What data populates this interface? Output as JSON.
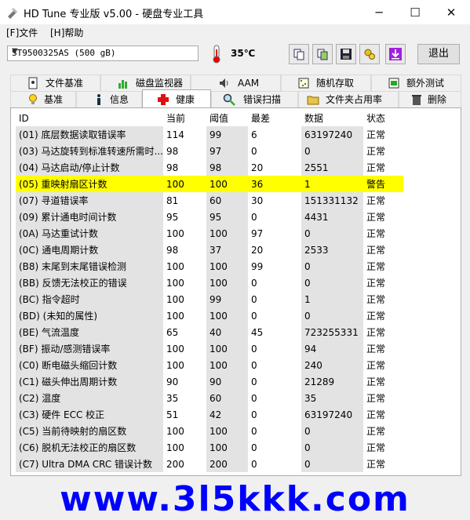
{
  "window": {
    "title": "HD Tune 专业版 v5.00 - 硬盘专业工具",
    "minimize": "─",
    "maximize": "☐",
    "close": "✕"
  },
  "menu": [
    "[F]文件",
    "[H]帮助"
  ],
  "toolbar": {
    "drive": "ST9500325AS (500 gB)",
    "temperature": "35℃",
    "buttons": [
      "copy-icon",
      "copy-info-icon",
      "save-icon",
      "options-icon",
      "download-icon"
    ],
    "exit_label": "退出"
  },
  "tabs_top": [
    "文件基准",
    "磁盘监视器",
    "AAM",
    "随机存取",
    "额外测试"
  ],
  "tabs_bottom": [
    "基准",
    "信息",
    "健康",
    "错误扫描",
    "文件夹占用率",
    "删除"
  ],
  "active_tab": "健康",
  "table": {
    "headers": [
      "ID",
      "当前",
      "阈值",
      "最差",
      "数据",
      "状态"
    ],
    "rows": [
      [
        "(01) 底层数据读取错误率",
        "114",
        "99",
        "6",
        "63197240",
        "正常"
      ],
      [
        "(03) 马达旋转到标准转速所需时...",
        "98",
        "97",
        "0",
        "0",
        "正常"
      ],
      [
        "(04) 马达启动/停止计数",
        "98",
        "98",
        "20",
        "2551",
        "正常"
      ],
      [
        "(05) 重映射扇区计数",
        "100",
        "100",
        "36",
        "1",
        "警告"
      ],
      [
        "(07) 寻道错误率",
        "81",
        "60",
        "30",
        "151331132",
        "正常"
      ],
      [
        "(09) 累计通电时间计数",
        "95",
        "95",
        "0",
        "4431",
        "正常"
      ],
      [
        "(0A) 马达重试计数",
        "100",
        "100",
        "97",
        "0",
        "正常"
      ],
      [
        "(0C) 通电周期计数",
        "98",
        "37",
        "20",
        "2533",
        "正常"
      ],
      [
        "(B8) 末尾到末尾错误检测",
        "100",
        "100",
        "99",
        "0",
        "正常"
      ],
      [
        "(BB) 反馈无法校正的错误",
        "100",
        "100",
        "0",
        "0",
        "正常"
      ],
      [
        "(BC) 指令超时",
        "100",
        "99",
        "0",
        "1",
        "正常"
      ],
      [
        "(BD) (未知的属性)",
        "100",
        "100",
        "0",
        "0",
        "正常"
      ],
      [
        "(BE) 气流温度",
        "65",
        "40",
        "45",
        "723255331",
        "正常"
      ],
      [
        "(BF) 振动/感测错误率",
        "100",
        "100",
        "0",
        "94",
        "正常"
      ],
      [
        "(C0) 断电磁头缩回计数",
        "100",
        "100",
        "0",
        "240",
        "正常"
      ],
      [
        "(C1) 磁头伸出周期计数",
        "90",
        "90",
        "0",
        "21289",
        "正常"
      ],
      [
        "(C2) 温度",
        "35",
        "60",
        "0",
        "35",
        "正常"
      ],
      [
        "(C3) 硬件 ECC 校正",
        "51",
        "42",
        "0",
        "63197240",
        "正常"
      ],
      [
        "(C5) 当前待映射的扇区数",
        "100",
        "100",
        "0",
        "0",
        "正常"
      ],
      [
        "(C6) 脱机无法校正的扇区数",
        "100",
        "100",
        "0",
        "0",
        "正常"
      ],
      [
        "(C7) Ultra DMA CRC 错误计数",
        "200",
        "200",
        "0",
        "0",
        "正常"
      ]
    ],
    "warn_row_index": 3,
    "warn_color": "#ffff00"
  },
  "watermark": "www.3l5kkk.com",
  "colors": {
    "watermark": "#0000ff",
    "warning_row": "#ffff00"
  }
}
